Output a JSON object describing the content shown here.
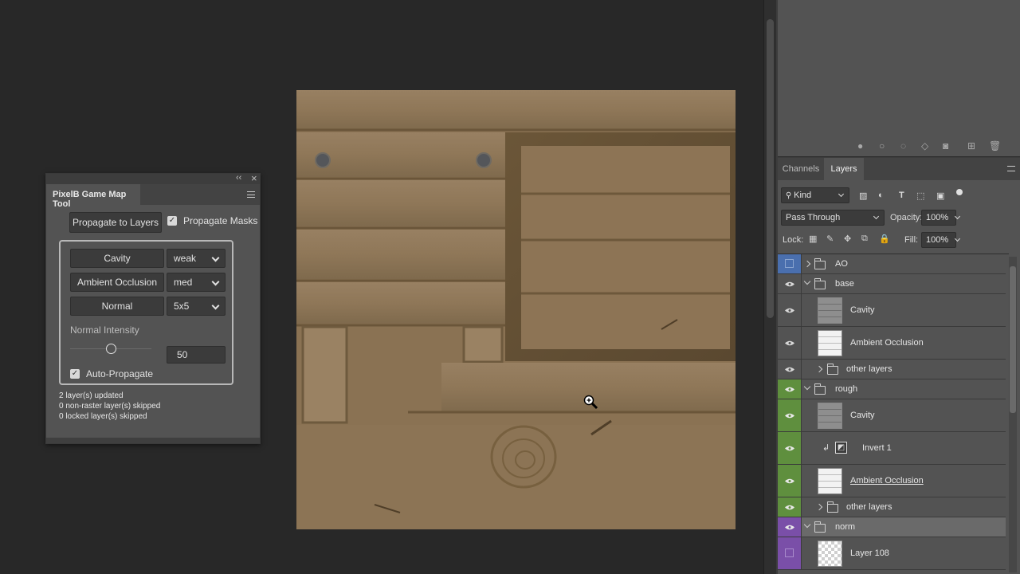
{
  "plugin": {
    "title": "PixelB Game Map Tool",
    "collapse_glyph": "‹‹",
    "close_glyph": "×",
    "propagate_layers_label": "Propagate to Layers",
    "propagate_masks_label": "Propagate Masks",
    "propagate_masks_checked": true,
    "options": [
      {
        "label": "Cavity",
        "value": "weak"
      },
      {
        "label": "Ambient Occlusion",
        "value": "med"
      },
      {
        "label": "Normal",
        "value": "5x5"
      }
    ],
    "intensity_label": "Normal Intensity",
    "intensity_value": "50",
    "auto_propagate_label": "Auto-Propagate",
    "auto_propagate_checked": true,
    "status": [
      "2 layer(s) updated",
      "0 non-raster layer(s) skipped",
      "0 locked layer(s) skipped"
    ]
  },
  "layers_panel": {
    "tabs": [
      "Channels",
      "Layers"
    ],
    "active_tab": "Layers",
    "filter_kind": "Kind",
    "blend_mode": "Pass Through",
    "opacity_label": "Opacity:",
    "opacity_value": "100%",
    "lock_label": "Lock:",
    "fill_label": "Fill:",
    "fill_value": "100%",
    "layers": [
      {
        "name": "AO",
        "type": "group",
        "expanded": false,
        "color": "#4a6fae",
        "visible": false,
        "indent": 0
      },
      {
        "name": "base",
        "type": "group",
        "expanded": true,
        "color": null,
        "visible": true,
        "indent": 0
      },
      {
        "name": "Cavity",
        "type": "pixel",
        "thumb": "cavity",
        "color": null,
        "visible": true,
        "indent": 1
      },
      {
        "name": "Ambient Occlusion",
        "type": "pixel",
        "thumb": "ao",
        "color": null,
        "visible": true,
        "indent": 1
      },
      {
        "name": "other layers",
        "type": "group",
        "expanded": false,
        "color": null,
        "visible": true,
        "indent": 1
      },
      {
        "name": "rough",
        "type": "group",
        "expanded": true,
        "color": "#5f8f3e",
        "visible": true,
        "indent": 0
      },
      {
        "name": "Cavity",
        "type": "pixel",
        "thumb": "cavity",
        "color": "#5f8f3e",
        "visible": true,
        "indent": 1
      },
      {
        "name": "Invert 1",
        "type": "adjustment",
        "color": "#5f8f3e",
        "visible": true,
        "indent": 1
      },
      {
        "name": "Ambient Occlusion",
        "type": "pixel",
        "thumb": "ao",
        "color": "#5f8f3e",
        "visible": true,
        "indent": 1,
        "underlined": true
      },
      {
        "name": "other layers",
        "type": "group",
        "expanded": false,
        "color": "#5f8f3e",
        "visible": true,
        "indent": 1
      },
      {
        "name": "norm",
        "type": "group",
        "expanded": true,
        "color": "#7a4fa8",
        "visible": true,
        "indent": 0,
        "selected": true
      },
      {
        "name": "Layer 108",
        "type": "pixel",
        "thumb": "transparent",
        "color": "#7a4fa8",
        "visible": false,
        "indent": 1
      }
    ]
  },
  "colors": {
    "canvas_bg": "#282828",
    "panel_bg": "#535353",
    "wood": "#8c7454"
  }
}
